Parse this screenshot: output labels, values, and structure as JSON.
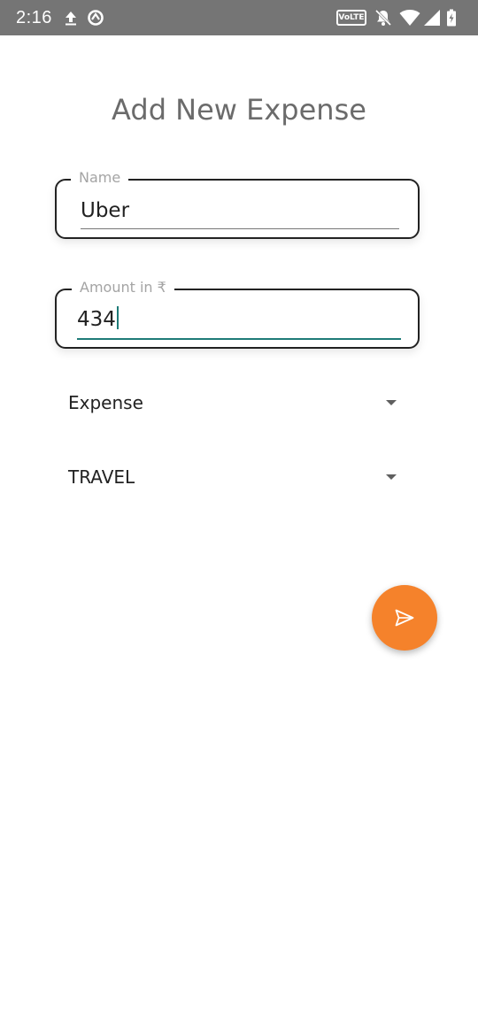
{
  "status_bar": {
    "time": "2:16",
    "volte_label": "VoLTE",
    "icons": [
      "upload-icon",
      "data-saver-icon",
      "volte-icon",
      "notifications-off-icon",
      "wifi-icon",
      "signal-icon",
      "battery-charging-icon"
    ]
  },
  "page": {
    "title": "Add New Expense"
  },
  "form": {
    "name": {
      "label": "Name",
      "value": "Uber"
    },
    "amount": {
      "label": "Amount in ₹",
      "value": "434"
    },
    "type_dropdown": {
      "selected": "Expense",
      "icon": "arrow-drop-down-icon"
    },
    "category_dropdown": {
      "selected": "TRAVEL",
      "icon": "arrow-drop-down-icon"
    },
    "submit": {
      "icon": "send-icon"
    }
  },
  "colors": {
    "status_bar": "#757575",
    "accent": "#1e7b78",
    "fab": "#f5822b"
  }
}
